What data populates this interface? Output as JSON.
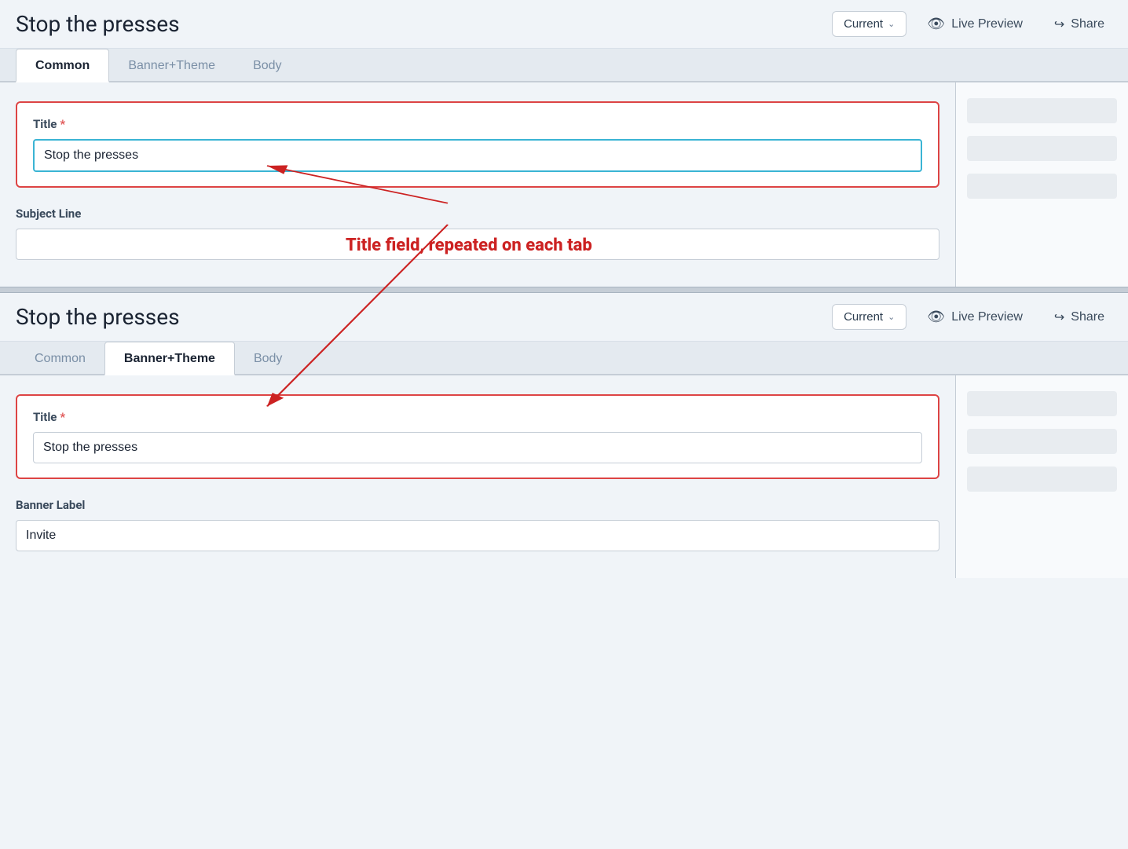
{
  "panel1": {
    "header": {
      "title": "Stop the presses",
      "dropdown_label": "Current",
      "live_preview_label": "Live Preview",
      "share_label": "Share"
    },
    "tabs": [
      {
        "id": "common",
        "label": "Common",
        "active": true
      },
      {
        "id": "banner-theme",
        "label": "Banner+Theme",
        "active": false
      },
      {
        "id": "body",
        "label": "Body",
        "active": false
      }
    ],
    "form": {
      "title_label": "Title",
      "title_required": "*",
      "title_value": "Stop the presses",
      "subject_label": "Subject Line",
      "subject_value": ""
    }
  },
  "panel2": {
    "header": {
      "title": "Stop the presses",
      "dropdown_label": "Current",
      "live_preview_label": "Live Preview",
      "share_label": "Share"
    },
    "tabs": [
      {
        "id": "common",
        "label": "Common",
        "active": false
      },
      {
        "id": "banner-theme",
        "label": "Banner+Theme",
        "active": true
      },
      {
        "id": "body",
        "label": "Body",
        "active": false
      }
    ],
    "form": {
      "title_label": "Title",
      "title_required": "*",
      "title_value": "Stop the presses",
      "banner_label": "Banner Label",
      "banner_value": "Invite"
    }
  },
  "annotation": {
    "text": "Title field, repeated on each tab"
  },
  "icons": {
    "eye": "👁",
    "share": "↪",
    "chevron_down": "∨"
  }
}
